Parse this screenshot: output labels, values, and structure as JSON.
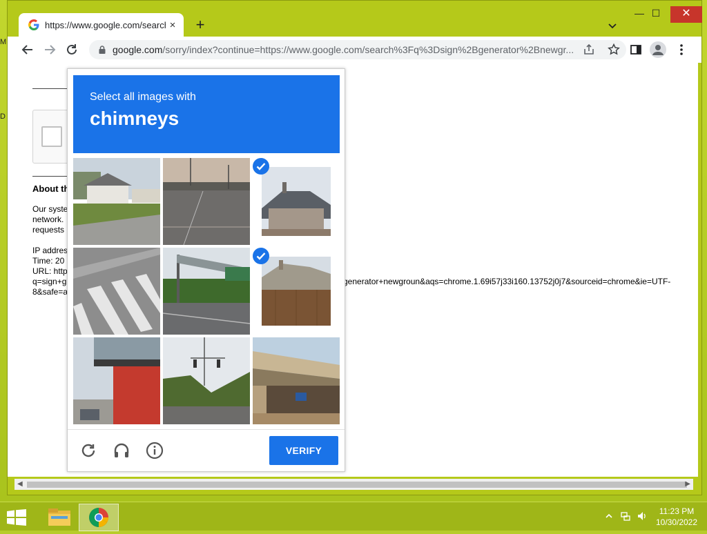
{
  "browser": {
    "tab_title": "https://www.google.com/search?q",
    "tab_close": "×",
    "new_tab": "+",
    "url_host": "google.com",
    "url_rest": "/sorry/index?continue=https://www.google.com/search%3Fq%3Dsign%2Bgenerator%2Bnewgr...",
    "window_controls": {
      "minimize": "—",
      "maximize": "☐",
      "close": "✕"
    }
  },
  "page": {
    "about_heading": "About th",
    "body_lines": [
      "Our syste",
      "network.",
      "requests"
    ],
    "info_lines": [
      "IP addres",
      "Time: 20",
      "URL: http",
      "q=sign+g",
      "8&safe=a"
    ],
    "url_tail": "generator+newgroun&aqs=chrome.1.69i57j33i160.13752j0j7&sourceid=chrome&ie=UTF-",
    "left_edge_letters": [
      "M",
      "D"
    ]
  },
  "captcha": {
    "instruction": "Select all images with",
    "target": "chimneys",
    "verify_label": "VERIFY",
    "tiles": [
      {
        "id": 1,
        "selected": false,
        "scene": "house-lawn"
      },
      {
        "id": 2,
        "selected": false,
        "scene": "road-traffic"
      },
      {
        "id": 3,
        "selected": true,
        "scene": "house-chimney"
      },
      {
        "id": 4,
        "selected": false,
        "scene": "crosswalk"
      },
      {
        "id": 5,
        "selected": false,
        "scene": "highway-sign"
      },
      {
        "id": 6,
        "selected": true,
        "scene": "fence-house"
      },
      {
        "id": 7,
        "selected": false,
        "scene": "red-building"
      },
      {
        "id": 8,
        "selected": false,
        "scene": "traffic-light"
      },
      {
        "id": 9,
        "selected": false,
        "scene": "bridge"
      }
    ],
    "accent_color": "#1a73e8"
  },
  "taskbar": {
    "clock_time": "11:23 PM",
    "clock_date": "10/30/2022"
  }
}
